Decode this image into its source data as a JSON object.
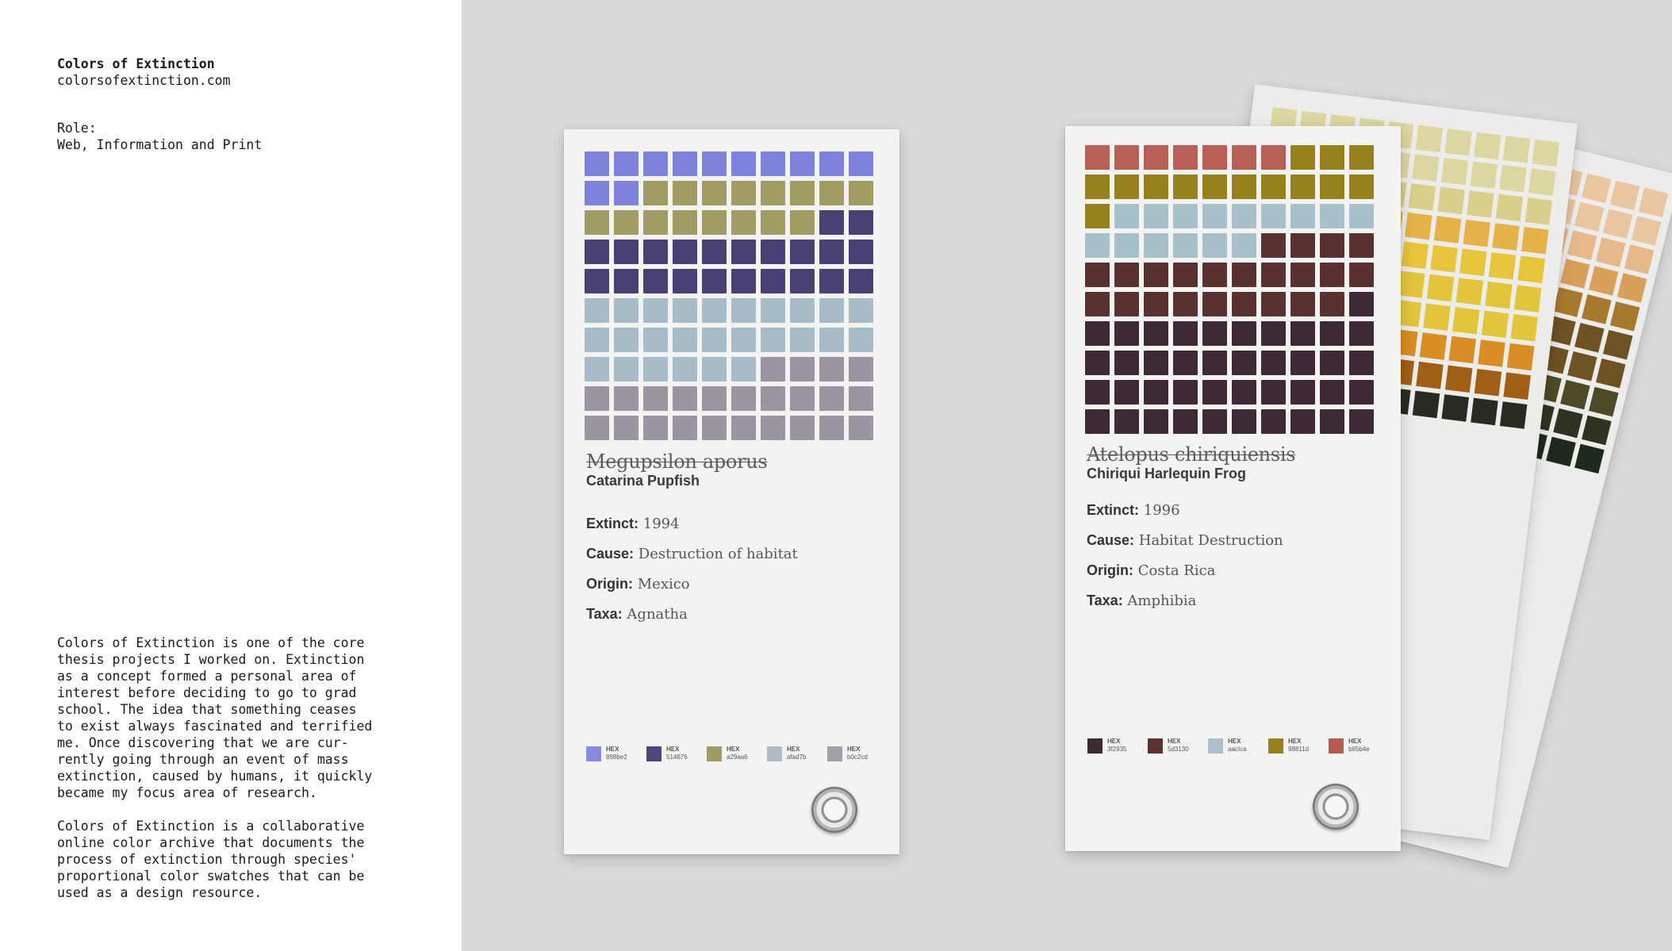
{
  "project": {
    "title": "Colors of Extinction",
    "url": "colorsofextinction.com",
    "role_label": "Role:",
    "role_value": "Web, Information and Print",
    "description_1": "Colors of Extinction is one of the core\nthesis projects I worked on. Extinction\nas a concept formed a personal area of\ninterest  before deciding to go to grad\nschool. The idea that something ceases\nto exist always fascinated and terrified\nme. Once discovering that we are cur-\nrently going through an event of mass\nextinction, caused by humans, it quickly\nbecame my focus area of research.",
    "description_2": "Colors of Extinction is a collaborative\nonline color archive that documents the\nprocess of extinction through species'\nproportional color swatches that can be\nused as a design resource."
  },
  "cards": [
    {
      "scientific_name": "Megupsilon aporus",
      "common_name": "Catarina Pupfish",
      "facts": [
        {
          "label": "Extinct:",
          "value": "1994"
        },
        {
          "label": "Cause:",
          "value": "Destruction of habitat"
        },
        {
          "label": "Origin:",
          "value": "Mexico"
        },
        {
          "label": "Taxa:",
          "value": "Agnatha"
        }
      ],
      "swatch_counts": [
        12,
        16,
        22,
        26,
        24
      ],
      "swatches": [
        {
          "label": "HEX",
          "hex": "898be2",
          "color": "#898be2"
        },
        {
          "label": "HEX",
          "hex": "514676",
          "color": "#514676"
        },
        {
          "label": "HEX",
          "hex": "a29aa6",
          "color": "#a29a66"
        },
        {
          "label": "HEX",
          "hex": "afad7b",
          "color": "#afbdc7"
        },
        {
          "label": "HEX",
          "hex": "b0c2cd",
          "color": "#a49ea8"
        }
      ]
    },
    {
      "scientific_name": "Atelopus chiriquiensis",
      "common_name": "Chiriqui Harlequin Frog",
      "facts": [
        {
          "label": "Extinct:",
          "value": "1996"
        },
        {
          "label": "Cause:",
          "value": "Habitat Destruction"
        },
        {
          "label": "Origin:",
          "value": "Costa Rica"
        },
        {
          "label": "Taxa:",
          "value": "Amphibia"
        }
      ],
      "swatch_counts": [
        7,
        14,
        15,
        23,
        41
      ],
      "swatches": [
        {
          "label": "HEX",
          "hex": "3f2935",
          "color": "#3f2935"
        },
        {
          "label": "HEX",
          "hex": "5d3130",
          "color": "#5d3130"
        },
        {
          "label": "HEX",
          "hex": "aacIca",
          "color": "#aac1ca"
        },
        {
          "label": "HEX",
          "hex": "98811d",
          "color": "#98811d"
        },
        {
          "label": "HEX",
          "hex": "b65b4e",
          "color": "#b65b4e"
        }
      ]
    }
  ],
  "colors": {
    "card1_cells": [
      "#7f82dc",
      "#a19c63",
      "#4a3f73",
      "#a7bcc8",
      "#9b94a1"
    ],
    "card2_cells": [
      "#b95f55",
      "#97811c",
      "#a8c0c9",
      "#5a3131",
      "#3e2a36"
    ]
  }
}
